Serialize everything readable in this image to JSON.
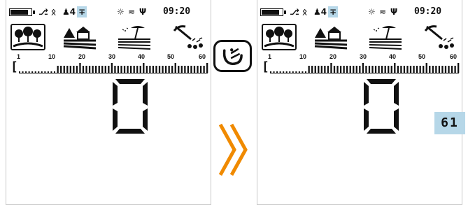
{
  "status": {
    "time": "09:20",
    "battery_level": 0.85,
    "icons": [
      "battery-icon",
      "headphones-icon",
      "bluetooth-icon",
      "person-4-icon",
      "ground-balance-icon",
      "brightness-icon",
      "vibration-icon",
      "light-icon"
    ],
    "person_text": "4",
    "highlight_color": "#b6d7e8"
  },
  "modes": [
    "park-mode-icon",
    "field-mode-icon",
    "beach-mode-icon",
    "prospecting-mode-icon"
  ],
  "scale": {
    "labels": [
      "1",
      "10",
      "20",
      "30",
      "40",
      "50",
      "60"
    ],
    "bracket": "["
  },
  "display": {
    "digit_left": "0",
    "digit_right": "0",
    "target_id": "61"
  },
  "arrow_color": "#f08a00"
}
